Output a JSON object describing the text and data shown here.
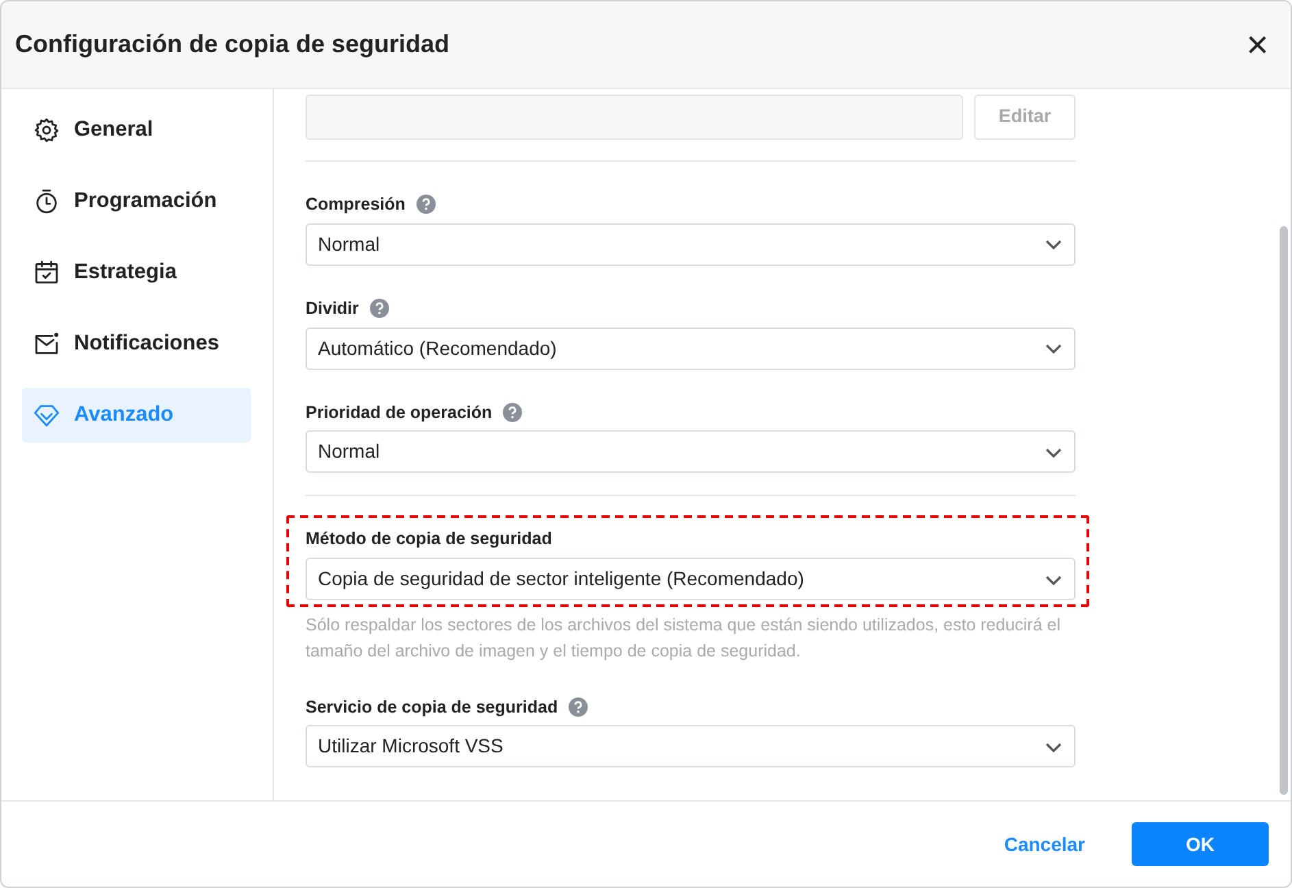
{
  "window": {
    "title": "Configuración de copia de seguridad",
    "close": "×"
  },
  "sidebar": {
    "items": [
      {
        "label": "General",
        "selected": false
      },
      {
        "label": "Programación",
        "selected": false
      },
      {
        "label": "Estrategia",
        "selected": false
      },
      {
        "label": "Notificaciones",
        "selected": false
      },
      {
        "label": "Avanzado",
        "selected": true
      }
    ]
  },
  "path_row": {
    "button": "Editar",
    "disabled": true
  },
  "setting_groups": [
    {
      "settings": [
        {
          "label": "Compresión",
          "help": true,
          "value": "Normal",
          "highlighted": false
        },
        {
          "label": "Dividir",
          "help": true,
          "value": "Automático (Recomendado)",
          "highlighted": false
        },
        {
          "label": "Prioridad de operación",
          "help": true,
          "value": "Normal",
          "highlighted": false
        }
      ]
    },
    {
      "settings": [
        {
          "label": "Método de copia de seguridad",
          "help": false,
          "value": "Copia de seguridad de sector inteligente (Recomendado)",
          "highlighted": true,
          "note": "Sólo respaldar los sectores de los archivos del sistema que están siendo utilizados, esto reducirá el tamaño del archivo de imagen y el tiempo de copia de seguridad."
        },
        {
          "label": "Servicio de copia de seguridad",
          "help": true,
          "value": "Utilizar Microsoft VSS",
          "highlighted": false
        }
      ]
    }
  ],
  "footer": {
    "cancel": "Cancelar",
    "ok": "OK"
  }
}
